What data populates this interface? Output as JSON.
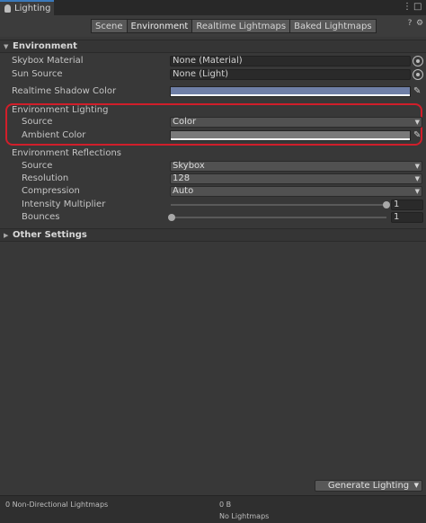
{
  "window": {
    "tab_title": "Lighting"
  },
  "tabs": [
    "Scene",
    "Environment",
    "Realtime Lightmaps",
    "Baked Lightmaps"
  ],
  "environment": {
    "header": "Environment",
    "skybox_material": {
      "label": "Skybox Material",
      "value": "None (Material)"
    },
    "sun_source": {
      "label": "Sun Source",
      "value": "None (Light)"
    },
    "realtime_shadow_color": {
      "label": "Realtime Shadow Color",
      "color": "#6f7fa7"
    }
  },
  "environment_lighting": {
    "header": "Environment Lighting",
    "source": {
      "label": "Source",
      "value": "Color"
    },
    "ambient_color": {
      "label": "Ambient Color",
      "color": "#7a7a7a"
    }
  },
  "environment_reflections": {
    "header": "Environment Reflections",
    "source": {
      "label": "Source",
      "value": "Skybox"
    },
    "resolution": {
      "label": "Resolution",
      "value": "128"
    },
    "compression": {
      "label": "Compression",
      "value": "Auto"
    },
    "intensity_multiplier": {
      "label": "Intensity Multiplier",
      "value": "1"
    },
    "bounces": {
      "label": "Bounces",
      "value": "1"
    }
  },
  "other_settings": {
    "header": "Other Settings"
  },
  "actions": {
    "generate_lighting": "Generate Lighting"
  },
  "footer": {
    "lightmaps": "0 Non-Directional Lightmaps",
    "size": "0 B",
    "status": "No Lightmaps"
  },
  "colors": {
    "highlight": "#d11e2a",
    "accent": "#3a79bb"
  }
}
